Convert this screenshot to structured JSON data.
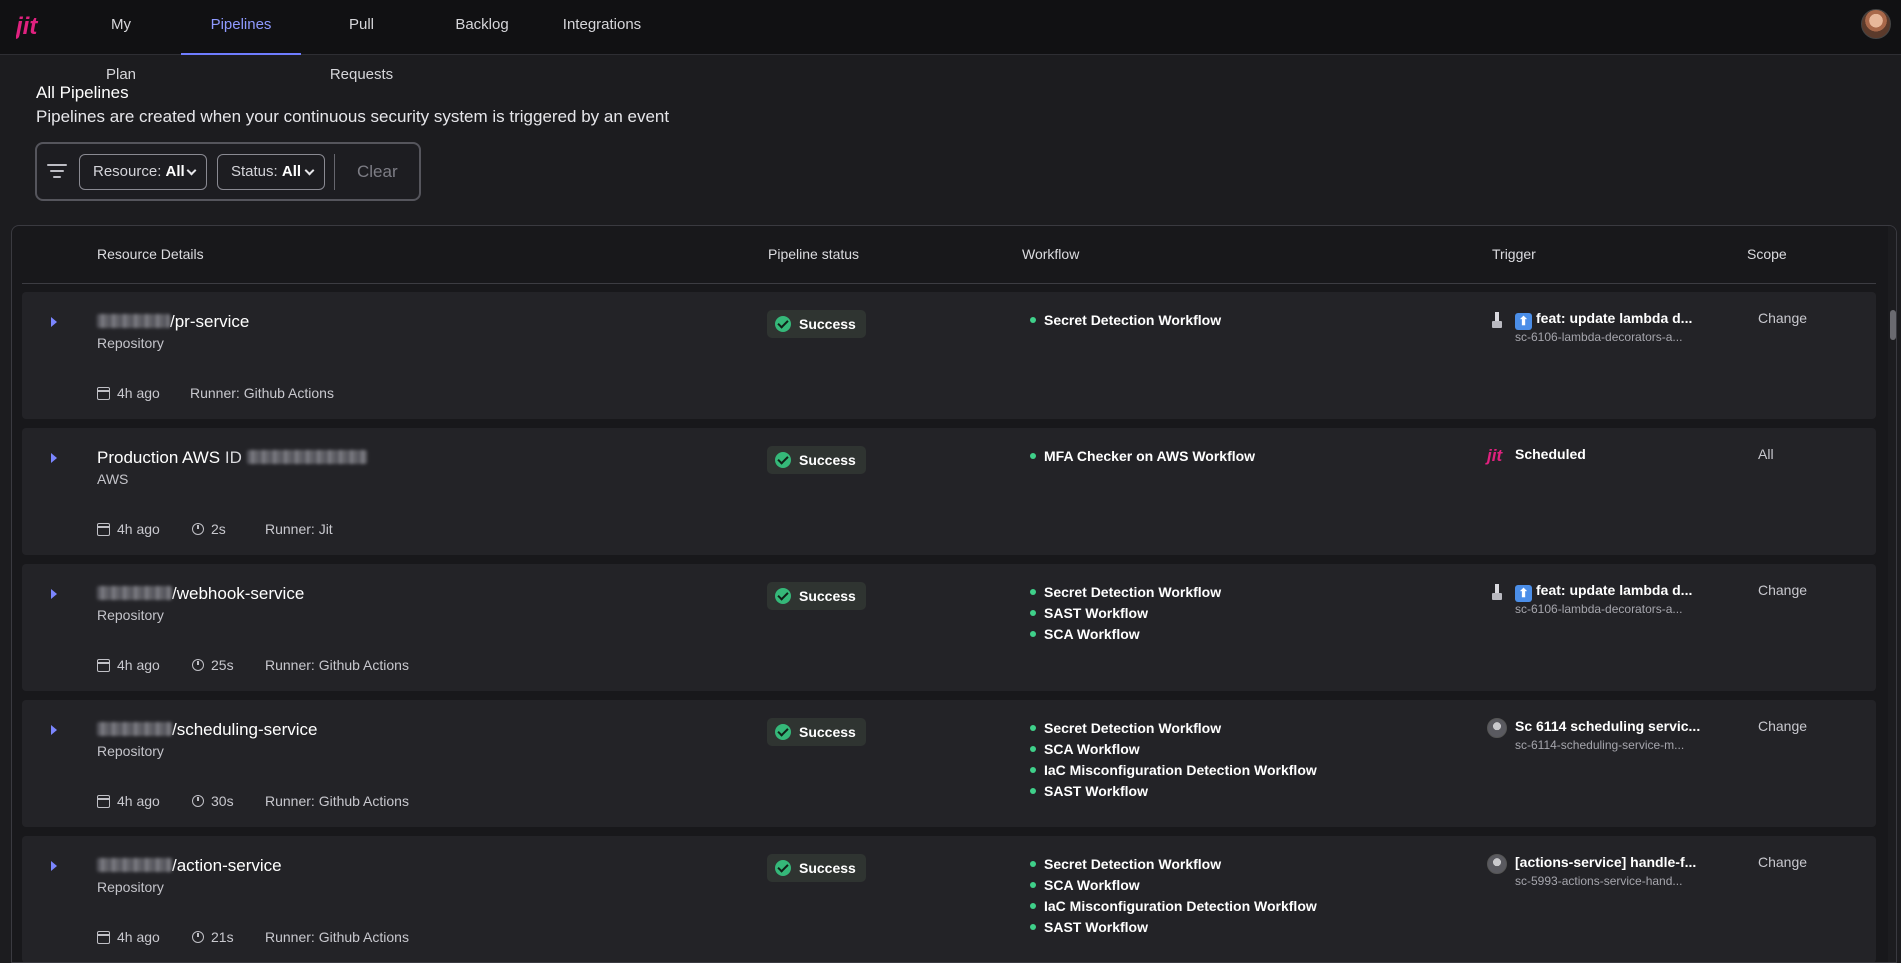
{
  "nav": {
    "items": [
      {
        "label": "My Plan"
      },
      {
        "label": "Pipelines"
      },
      {
        "label": "Pull Requests"
      },
      {
        "label": "Backlog"
      },
      {
        "label": "Integrations"
      }
    ],
    "active": "Pipelines",
    "brand_color": "#e0217f",
    "accent_color": "#8f9aff"
  },
  "header": {
    "title": "All Pipelines",
    "subtitle": "Pipelines are created when your continuous security system is triggered by an event"
  },
  "filters": {
    "resource_label": "Resource:",
    "resource_value": "All",
    "status_label": "Status:",
    "status_value": "All",
    "clear_label": "Clear"
  },
  "table": {
    "columns": [
      "Resource Details",
      "Pipeline status",
      "Workflow",
      "Trigger",
      "Scope"
    ],
    "rows": [
      {
        "name": "/pr-service",
        "type": "Repository",
        "age": "4h ago",
        "runner": "Runner: Github Actions",
        "status": "Success",
        "workflows": [
          "Secret Detection Workflow"
        ],
        "trigger_icon": "broom-icon",
        "trigger_title": "feat: update lambda d...",
        "trigger_arrow": "⬆",
        "trigger_sub": "sc-6106-lambda-decorators-a...",
        "scope": "Change"
      },
      {
        "name": "Production AWS",
        "name_suffix": "ID",
        "type": "AWS",
        "age": "4h ago",
        "duration": "2s",
        "runner": "Runner: Jit",
        "status": "Success",
        "workflows": [
          "MFA Checker on AWS Workflow"
        ],
        "trigger_icon": "jit-logo-icon",
        "trigger_title": "Scheduled",
        "scope": "All"
      },
      {
        "name": "/webhook-service",
        "type": "Repository",
        "age": "4h ago",
        "duration": "25s",
        "runner": "Runner: Github Actions",
        "status": "Success",
        "workflows": [
          "Secret Detection Workflow",
          "SAST Workflow",
          "SCA Workflow"
        ],
        "trigger_icon": "broom-icon",
        "trigger_title": "feat: update lambda d...",
        "trigger_arrow": "⬆",
        "trigger_sub": "sc-6106-lambda-decorators-a...",
        "scope": "Change"
      },
      {
        "name": "/scheduling-service",
        "type": "Repository",
        "age": "4h ago",
        "duration": "30s",
        "runner": "Runner: Github Actions",
        "status": "Success",
        "workflows": [
          "Secret Detection Workflow",
          "SCA Workflow",
          "IaC Misconfiguration Detection Workflow",
          "SAST Workflow"
        ],
        "trigger_icon": "user-avatar-icon",
        "trigger_title": "Sc 6114 scheduling servic...",
        "trigger_sub": "sc-6114-scheduling-service-m...",
        "scope": "Change"
      },
      {
        "name": "/action-service",
        "type": "Repository",
        "age": "4h ago",
        "duration": "21s",
        "runner": "Runner: Github Actions",
        "status": "Success",
        "workflows": [
          "Secret Detection Workflow",
          "SCA Workflow",
          "IaC Misconfiguration Detection Workflow",
          "SAST Workflow"
        ],
        "trigger_icon": "user-avatar-icon",
        "trigger_title": "[actions-service] handle-f...",
        "trigger_sub": "sc-5993-actions-service-hand...",
        "scope": "Change"
      }
    ]
  }
}
